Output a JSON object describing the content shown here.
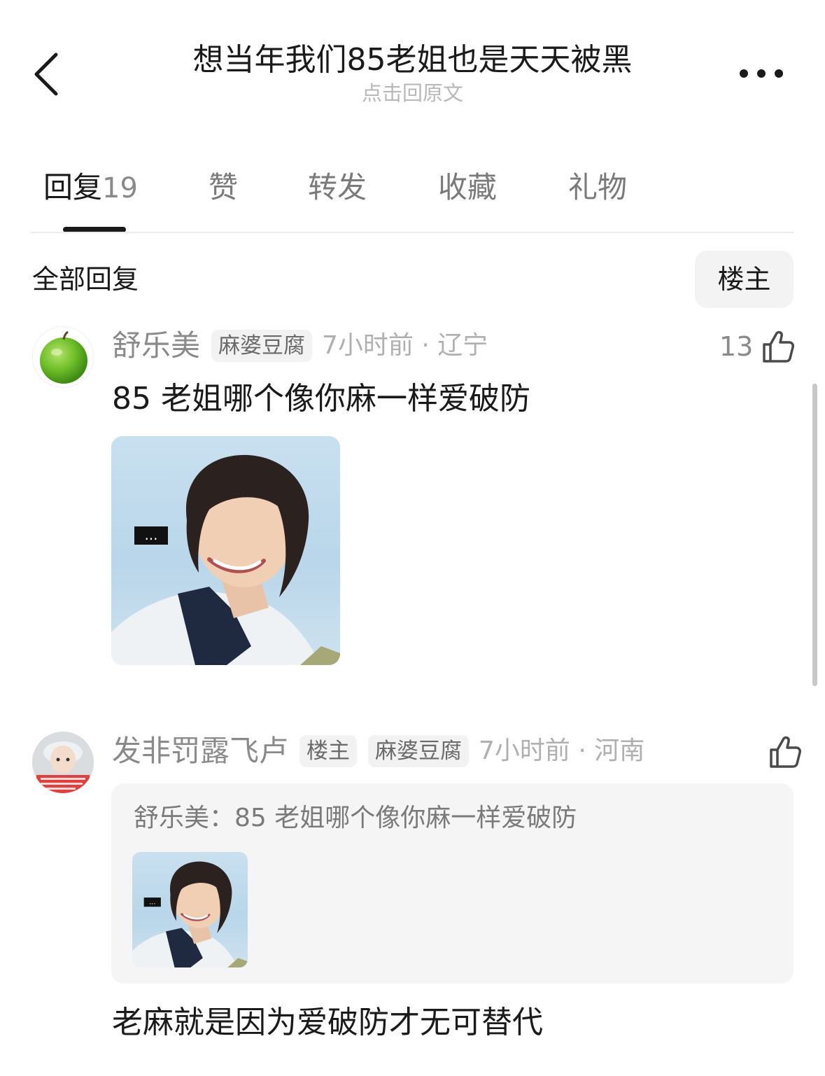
{
  "header": {
    "title": "想当年我们85老姐也是天天被黑",
    "subtitle": "点击回原文",
    "back_icon": "chevron-left-icon",
    "more_icon": "more-dots-icon"
  },
  "tabs": [
    {
      "label": "回复",
      "count": "19",
      "active": true
    },
    {
      "label": "赞"
    },
    {
      "label": "转发"
    },
    {
      "label": "收藏"
    },
    {
      "label": "礼物"
    }
  ],
  "section": {
    "title": "全部回复",
    "filter_label": "楼主"
  },
  "comments": [
    {
      "username": "舒乐美",
      "badges": [
        "麻婆豆腐"
      ],
      "time_location": "7小时前 · 辽宁",
      "like_count": "13",
      "text": "85 老姐哪个像你麻一样爱破防",
      "image_caption": "..."
    },
    {
      "username": "发非罚露飞卢",
      "badges": [
        "楼主",
        "麻婆豆腐"
      ],
      "time_location": "7小时前 · 河南",
      "like_count": "",
      "quote": {
        "author": "舒乐美：",
        "text": "85 老姐哪个像你麻一样爱破防",
        "image_caption": "..."
      },
      "text": "老麻就是因为爱破防才无可替代"
    }
  ],
  "colors": {
    "text_primary": "#1a1a1a",
    "text_secondary": "#8a8a8a",
    "badge_bg": "#f2f2f2",
    "quote_bg": "#f5f5f5"
  }
}
